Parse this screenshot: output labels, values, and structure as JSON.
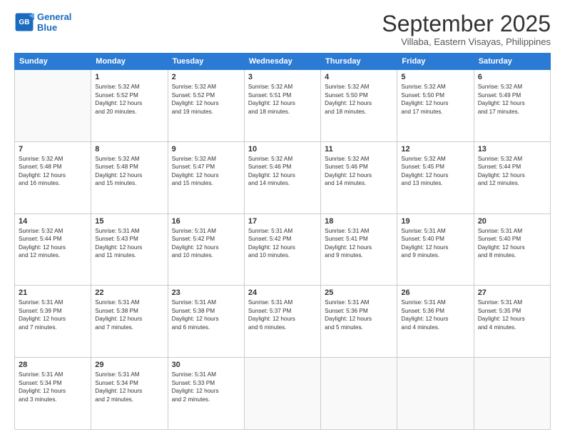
{
  "logo": {
    "line1": "General",
    "line2": "Blue"
  },
  "title": "September 2025",
  "location": "Villaba, Eastern Visayas, Philippines",
  "days": [
    "Sunday",
    "Monday",
    "Tuesday",
    "Wednesday",
    "Thursday",
    "Friday",
    "Saturday"
  ],
  "weeks": [
    [
      {
        "day": "",
        "content": ""
      },
      {
        "day": "1",
        "content": "Sunrise: 5:32 AM\nSunset: 5:52 PM\nDaylight: 12 hours\nand 20 minutes."
      },
      {
        "day": "2",
        "content": "Sunrise: 5:32 AM\nSunset: 5:52 PM\nDaylight: 12 hours\nand 19 minutes."
      },
      {
        "day": "3",
        "content": "Sunrise: 5:32 AM\nSunset: 5:51 PM\nDaylight: 12 hours\nand 18 minutes."
      },
      {
        "day": "4",
        "content": "Sunrise: 5:32 AM\nSunset: 5:50 PM\nDaylight: 12 hours\nand 18 minutes."
      },
      {
        "day": "5",
        "content": "Sunrise: 5:32 AM\nSunset: 5:50 PM\nDaylight: 12 hours\nand 17 minutes."
      },
      {
        "day": "6",
        "content": "Sunrise: 5:32 AM\nSunset: 5:49 PM\nDaylight: 12 hours\nand 17 minutes."
      }
    ],
    [
      {
        "day": "7",
        "content": "Sunrise: 5:32 AM\nSunset: 5:48 PM\nDaylight: 12 hours\nand 16 minutes."
      },
      {
        "day": "8",
        "content": "Sunrise: 5:32 AM\nSunset: 5:48 PM\nDaylight: 12 hours\nand 15 minutes."
      },
      {
        "day": "9",
        "content": "Sunrise: 5:32 AM\nSunset: 5:47 PM\nDaylight: 12 hours\nand 15 minutes."
      },
      {
        "day": "10",
        "content": "Sunrise: 5:32 AM\nSunset: 5:46 PM\nDaylight: 12 hours\nand 14 minutes."
      },
      {
        "day": "11",
        "content": "Sunrise: 5:32 AM\nSunset: 5:46 PM\nDaylight: 12 hours\nand 14 minutes."
      },
      {
        "day": "12",
        "content": "Sunrise: 5:32 AM\nSunset: 5:45 PM\nDaylight: 12 hours\nand 13 minutes."
      },
      {
        "day": "13",
        "content": "Sunrise: 5:32 AM\nSunset: 5:44 PM\nDaylight: 12 hours\nand 12 minutes."
      }
    ],
    [
      {
        "day": "14",
        "content": "Sunrise: 5:32 AM\nSunset: 5:44 PM\nDaylight: 12 hours\nand 12 minutes."
      },
      {
        "day": "15",
        "content": "Sunrise: 5:31 AM\nSunset: 5:43 PM\nDaylight: 12 hours\nand 11 minutes."
      },
      {
        "day": "16",
        "content": "Sunrise: 5:31 AM\nSunset: 5:42 PM\nDaylight: 12 hours\nand 10 minutes."
      },
      {
        "day": "17",
        "content": "Sunrise: 5:31 AM\nSunset: 5:42 PM\nDaylight: 12 hours\nand 10 minutes."
      },
      {
        "day": "18",
        "content": "Sunrise: 5:31 AM\nSunset: 5:41 PM\nDaylight: 12 hours\nand 9 minutes."
      },
      {
        "day": "19",
        "content": "Sunrise: 5:31 AM\nSunset: 5:40 PM\nDaylight: 12 hours\nand 9 minutes."
      },
      {
        "day": "20",
        "content": "Sunrise: 5:31 AM\nSunset: 5:40 PM\nDaylight: 12 hours\nand 8 minutes."
      }
    ],
    [
      {
        "day": "21",
        "content": "Sunrise: 5:31 AM\nSunset: 5:39 PM\nDaylight: 12 hours\nand 7 minutes."
      },
      {
        "day": "22",
        "content": "Sunrise: 5:31 AM\nSunset: 5:38 PM\nDaylight: 12 hours\nand 7 minutes."
      },
      {
        "day": "23",
        "content": "Sunrise: 5:31 AM\nSunset: 5:38 PM\nDaylight: 12 hours\nand 6 minutes."
      },
      {
        "day": "24",
        "content": "Sunrise: 5:31 AM\nSunset: 5:37 PM\nDaylight: 12 hours\nand 6 minutes."
      },
      {
        "day": "25",
        "content": "Sunrise: 5:31 AM\nSunset: 5:36 PM\nDaylight: 12 hours\nand 5 minutes."
      },
      {
        "day": "26",
        "content": "Sunrise: 5:31 AM\nSunset: 5:36 PM\nDaylight: 12 hours\nand 4 minutes."
      },
      {
        "day": "27",
        "content": "Sunrise: 5:31 AM\nSunset: 5:35 PM\nDaylight: 12 hours\nand 4 minutes."
      }
    ],
    [
      {
        "day": "28",
        "content": "Sunrise: 5:31 AM\nSunset: 5:34 PM\nDaylight: 12 hours\nand 3 minutes."
      },
      {
        "day": "29",
        "content": "Sunrise: 5:31 AM\nSunset: 5:34 PM\nDaylight: 12 hours\nand 2 minutes."
      },
      {
        "day": "30",
        "content": "Sunrise: 5:31 AM\nSunset: 5:33 PM\nDaylight: 12 hours\nand 2 minutes."
      },
      {
        "day": "",
        "content": ""
      },
      {
        "day": "",
        "content": ""
      },
      {
        "day": "",
        "content": ""
      },
      {
        "day": "",
        "content": ""
      }
    ]
  ]
}
